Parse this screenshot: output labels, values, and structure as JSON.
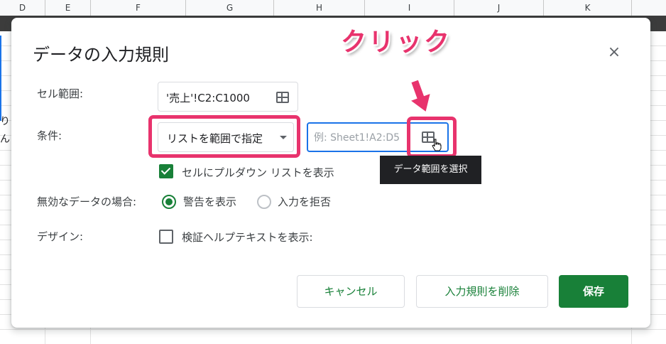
{
  "sheet": {
    "columns": [
      "D",
      "E",
      "F",
      "G",
      "H",
      "I",
      "J",
      "K"
    ],
    "left_fragments": [
      "り",
      "ん"
    ]
  },
  "dialog": {
    "title": "データの入力規則",
    "close_symbol": "×",
    "cell_range_label": "セル範囲:",
    "cell_range_value": "'売上'!C2:C1000",
    "criteria_label": "条件:",
    "criteria_value": "リストを範囲で指定",
    "source_placeholder": "例: Sheet1!A2:D5",
    "tooltip": "データ範囲を選択",
    "show_dropdown_label": "セルにプルダウン リストを表示",
    "show_dropdown_checked": true,
    "invalid_label": "無効なデータの場合:",
    "invalid_options": [
      {
        "label": "警告を表示",
        "selected": true
      },
      {
        "label": "入力を拒否",
        "selected": false
      }
    ],
    "design_label": "デザイン:",
    "help_text_label": "検証ヘルプテキストを表示:",
    "help_text_checked": false,
    "buttons": {
      "cancel": "キャンセル",
      "remove": "入力規則を削除",
      "save": "保存"
    }
  },
  "annotation": {
    "text": "クリック",
    "color": "#e8336d"
  },
  "colors": {
    "accent_green": "#188038",
    "focus_blue": "#1a73e8",
    "highlight_pink": "#e8336d"
  }
}
